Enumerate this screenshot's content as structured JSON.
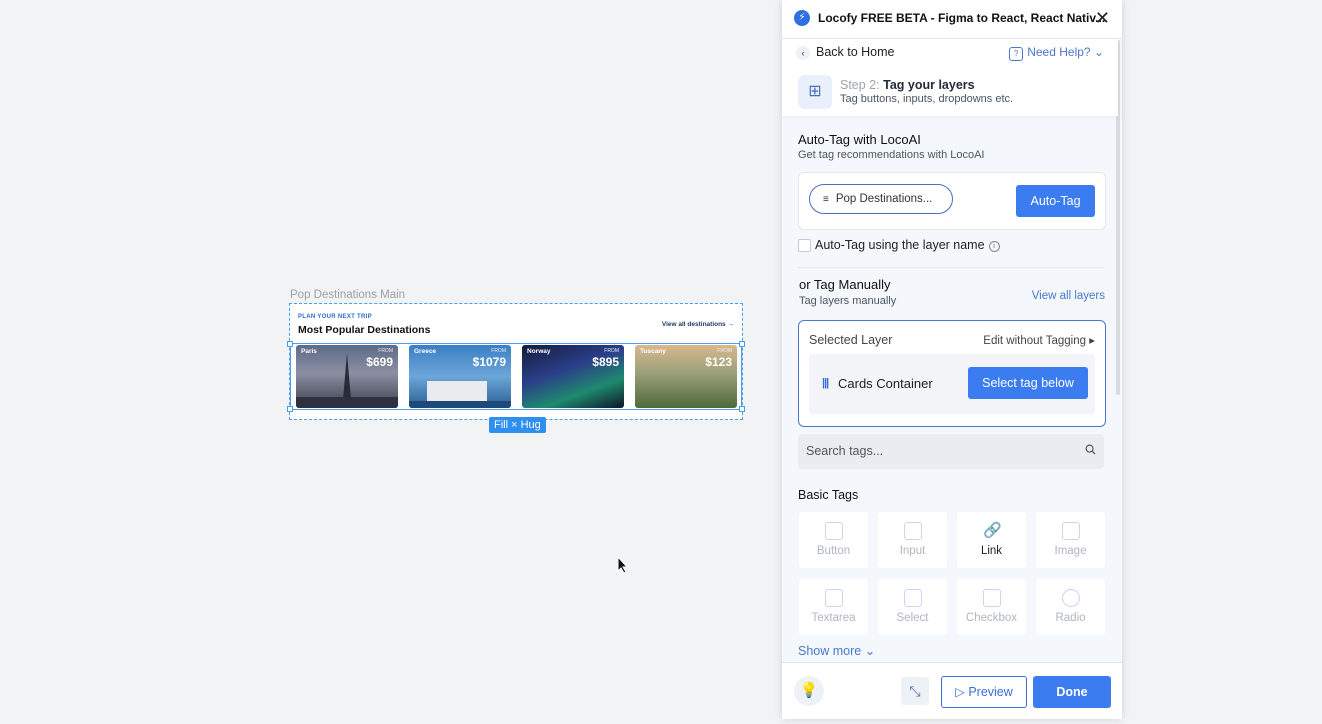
{
  "canvas": {
    "frame_label": "Pop Destinations Main",
    "eyebrow": "PLAN YOUR NEXT TRIP",
    "title": "Most Popular Destinations",
    "view_all": "View all destinations",
    "cards": [
      {
        "name": "Paris",
        "from": "FROM",
        "price": "$699"
      },
      {
        "name": "Greece",
        "from": "FROM",
        "price": "$1079"
      },
      {
        "name": "Norway",
        "from": "FROM",
        "price": "$895"
      },
      {
        "name": "Tuscany",
        "from": "FROM",
        "price": "$123"
      }
    ],
    "size_badge": "Fill × Hug"
  },
  "panel": {
    "title": "Locofy FREE BETA - Figma to React, React Nativ...",
    "back": "Back to Home",
    "help": "Need Help?",
    "step_prefix": "Step 2:",
    "step_title": "Tag your layers",
    "step_sub": "Tag buttons, inputs, dropdowns etc.",
    "auto_heading": "Auto-Tag with LocoAI",
    "auto_sub": "Get tag recommendations with LocoAI",
    "pop_pill": "Pop Destinations...",
    "auto_tag_button": "Auto-Tag",
    "auto_tag_checkbox": "Auto-Tag using the layer name",
    "manual_heading": "or Tag Manually",
    "manual_sub": "Tag layers manually",
    "view_all_layers": "View all layers",
    "selected_layer": "Selected Layer",
    "edit_without": "Edit without Tagging",
    "layer_name": "Cards Container",
    "select_tag_button": "Select tag below",
    "search_placeholder": "Search tags...",
    "basic_tags_heading": "Basic Tags",
    "tags": [
      {
        "label": "Button",
        "icon": "button-icon"
      },
      {
        "label": "Input",
        "icon": "input-icon"
      },
      {
        "label": "Link",
        "icon": "link-icon"
      },
      {
        "label": "Image",
        "icon": "image-icon"
      },
      {
        "label": "Textarea",
        "icon": "textarea-icon"
      },
      {
        "label": "Select",
        "icon": "select-icon"
      },
      {
        "label": "Checkbox",
        "icon": "checkbox-icon"
      },
      {
        "label": "Radio",
        "icon": "radio-icon"
      }
    ],
    "show_more": "Show more",
    "preview_button": "Preview",
    "done_button": "Done"
  },
  "colors": {
    "accent": "#3b7cf0",
    "selection": "#4a9df0"
  }
}
